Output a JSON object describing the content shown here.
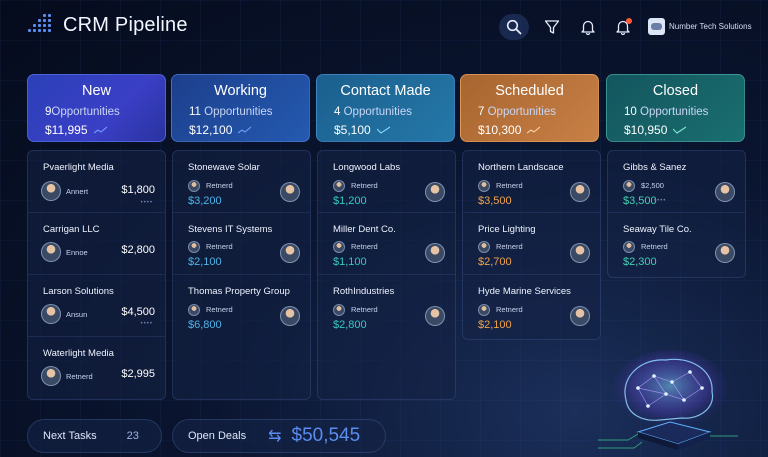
{
  "app": {
    "title": "CRM Pipeline",
    "org_name": "Number Tech Solutions"
  },
  "header_icons": [
    "search-icon",
    "filter-icon",
    "bell-icon",
    "alert-bell-icon"
  ],
  "columns": [
    {
      "stage": "New",
      "count_num": "9",
      "count_label": "Opportunities",
      "total": "$11,995",
      "cards": [
        {
          "company": "Pvaerlight Media",
          "owner": "Annert",
          "amount": "$1,800"
        },
        {
          "company": "Carrigan LLC",
          "owner": "Ennoe",
          "amount": "$2,800"
        },
        {
          "company": "Larson Solutions",
          "owner": "Ansun",
          "amount": "$4,500"
        },
        {
          "company": "Waterlight Media",
          "owner": "Retnerd",
          "amount": "$2,995"
        }
      ]
    },
    {
      "stage": "Working",
      "count_num": "11",
      "count_label": "Opportunities",
      "total": "$12,100",
      "cards": [
        {
          "company": "Stonewave Solar",
          "owner": "Retnerd",
          "amount": "$3,200"
        },
        {
          "company": "Stevens IT Systems",
          "owner": "Retnerd",
          "amount": "$2,100"
        },
        {
          "company": "Thomas Property Group",
          "owner": "Retnerd",
          "amount": "$6,800"
        }
      ]
    },
    {
      "stage": "Contact Made",
      "count_num": "4",
      "count_label": "Opportunities",
      "total": "$5,100",
      "cards": [
        {
          "company": "Longwood Labs",
          "owner": "Retnerd",
          "amount": "$1,200"
        },
        {
          "company": "Miller Dent Co.",
          "owner": "Retnerd",
          "amount": "$1,100"
        },
        {
          "company": "RothIndustries",
          "owner": "Retnerd",
          "amount": "$2,800"
        }
      ]
    },
    {
      "stage": "Scheduled",
      "count_num": "7",
      "count_label": "Opportunities",
      "total": "$10,300",
      "cards": [
        {
          "company": "Northern Landscace",
          "owner": "Retnerd",
          "amount": "$3,500"
        },
        {
          "company": "Price Lighting",
          "owner": "Retnerd",
          "amount": "$2,700"
        },
        {
          "company": "Hyde Marine Services",
          "owner": "Retnerd",
          "amount": "$2,100"
        }
      ]
    },
    {
      "stage": "Closed",
      "count_num": "10",
      "count_label": "Opportunities",
      "total": "$10,950",
      "cards": [
        {
          "company": "Gibbs & Sanez",
          "owner": "$2,500",
          "amount": "$3,500"
        },
        {
          "company": "Seaway Tile Co.",
          "owner": "Retnerd",
          "amount": "$2,300"
        }
      ]
    }
  ],
  "footer": {
    "tasks_label": "Next Tasks",
    "tasks_count": "23",
    "deals_label": "Open Deals",
    "deals_total": "$50,545"
  },
  "colors": {
    "accent": "#5b8df0",
    "amount_working": "#4fb3e8",
    "amount_contact": "#39c8c0",
    "amount_scheduled": "#f2a24a",
    "amount_closed": "#45d0b2"
  }
}
